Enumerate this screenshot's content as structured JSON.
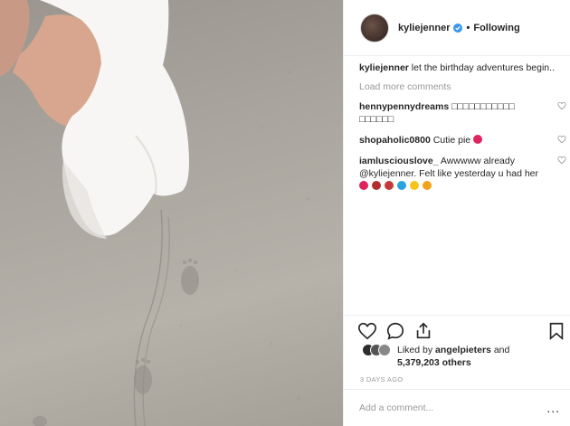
{
  "post": {
    "username": "kyliejenner",
    "follow_status": "Following",
    "separator": "•"
  },
  "caption": {
    "username": "kyliejenner",
    "text": "let the birthday adventures begin.."
  },
  "load_more_label": "Load more comments",
  "comments": [
    {
      "username": "hennypennydreams",
      "text": "□□□□□□□□□□□ □□□□□□"
    },
    {
      "username": "shopaholic0800",
      "text": "Cutie pie"
    },
    {
      "username": "iamlusciouslove_",
      "text": "Awwwww already @kyliejenner. Felt like yesterday u had her"
    }
  ],
  "likes": {
    "prefix": "Liked by",
    "user": "angelpieters",
    "and": "and",
    "count": "5,379,203 others"
  },
  "timestamp": "3 DAYS AGO",
  "add_comment_placeholder": "Add a comment...",
  "more_options": "...",
  "icons": {
    "verified": "verified-badge-icon",
    "like": "heart-icon",
    "comment": "comment-icon",
    "share": "share-icon",
    "save": "bookmark-icon",
    "comment_like": "small-heart-icon"
  },
  "colors": {
    "verified": "#3897f0",
    "muted": "#999999",
    "text": "#262626",
    "border": "#efefef"
  }
}
